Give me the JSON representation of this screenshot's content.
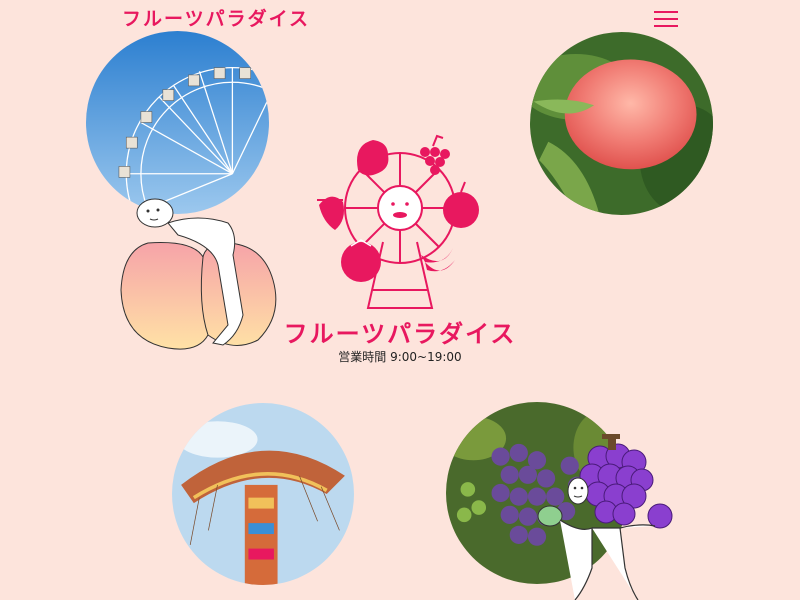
{
  "header": {
    "brand": "フルーツパラダイス",
    "menu_icon": "hamburger-menu-icon"
  },
  "hero": {
    "title": "フルーツパラダイス",
    "hours": "営業時間 9:00~19:00"
  },
  "colors": {
    "accent": "#e8185f",
    "background": "#fde4dc",
    "sky": "#3b8fd6",
    "grape": "#8a3fcf"
  },
  "photos": [
    {
      "subject": "ferris-wheel"
    },
    {
      "subject": "peach"
    },
    {
      "subject": "swing-ride"
    },
    {
      "subject": "grapes"
    }
  ]
}
